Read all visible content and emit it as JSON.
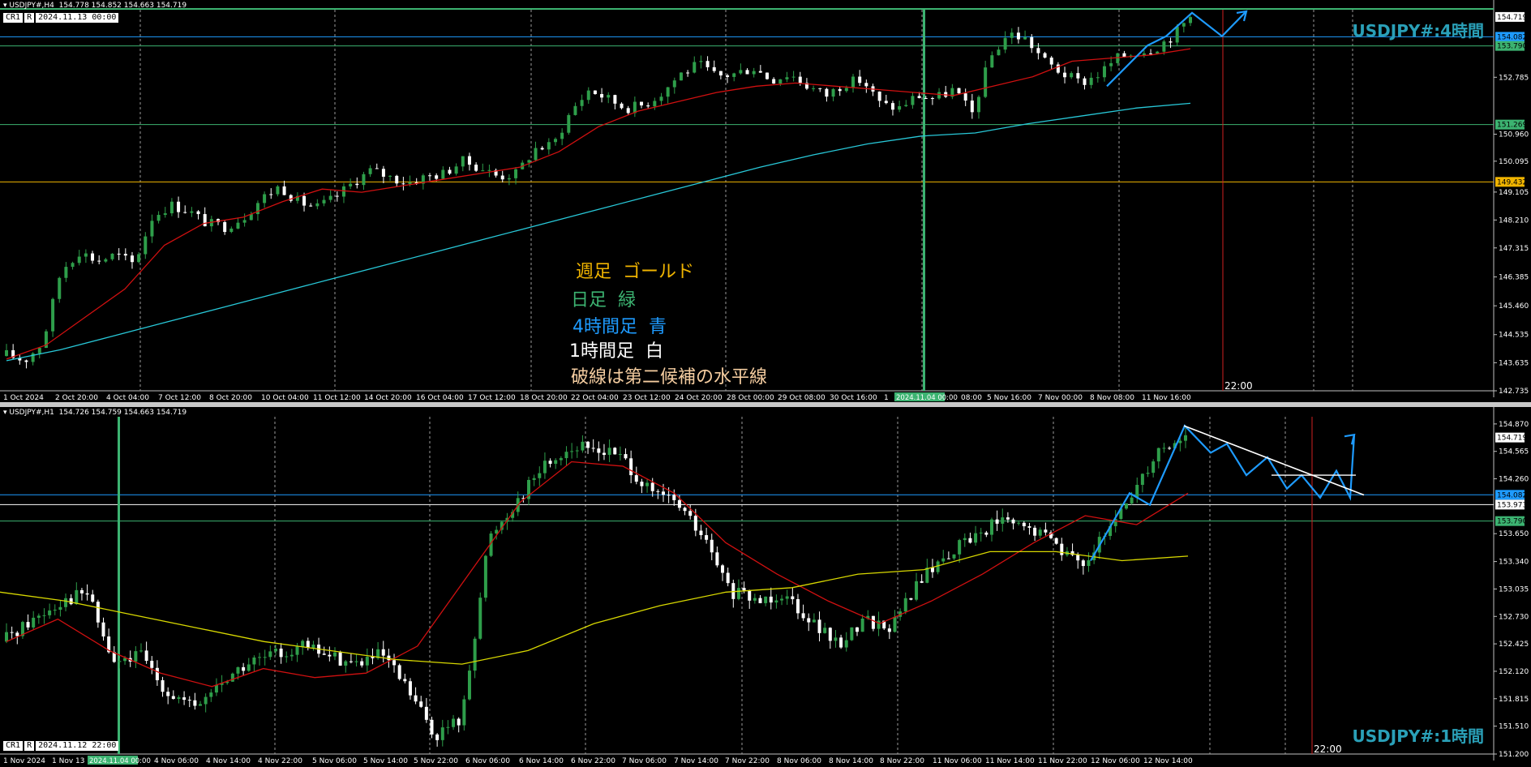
{
  "colors": {
    "weekly_gold": "#f0b400",
    "daily_green": "#3cb371",
    "h4_blue": "#1e9bff",
    "h1_white": "#ffffff",
    "dashed_label": "#f5cda0",
    "ma_red": "#d01010",
    "ma_cyan": "#28c8d8",
    "ma_yellow": "#d8d800",
    "bull": "#2e9e4a",
    "bear": "#ffffff",
    "grid": "#9a9a9a",
    "vline_red": "#d02020",
    "label_teal": "#2aa0b8"
  },
  "h4": {
    "header": "▾ USDJPY#,H4  154.778 154.852 154.663 154.719",
    "cr": "CR1",
    "r": "R",
    "date_box": "2024.11.13 00:00",
    "timeframe_label": "USDJPY#:4時間",
    "vline_label": "22:00",
    "legend": [
      "週足  ゴールド",
      "日足  緑",
      "4時間足  青",
      "1時間足  白",
      "破線は第二候補の水平線"
    ]
  },
  "h1": {
    "header": "▾ USDJPY#,H1  154.726 154.759 154.663 154.719",
    "cr": "CR1",
    "r": "R",
    "date_box": "2024.11.12 22:00",
    "timeframe_label": "USDJPY#:1時間",
    "vline_label": "22:00"
  },
  "chart_data": [
    {
      "type": "candlestick",
      "symbol": "USDJPY#",
      "timeframe": "H4",
      "ylim": [
        142.735,
        154.95
      ],
      "y_ticks": [
        154.719,
        154.082,
        153.79,
        152.785,
        151.269,
        150.96,
        150.095,
        149.432,
        149.105,
        148.21,
        147.315,
        146.385,
        145.46,
        144.535,
        143.635,
        142.735
      ],
      "price_tags": [
        {
          "value": 154.719,
          "style": "white"
        },
        {
          "value": 154.082,
          "style": "blue"
        },
        {
          "value": 153.79,
          "style": "green"
        },
        {
          "value": 151.269,
          "style": "green"
        },
        {
          "value": 149.432,
          "style": "gold"
        }
      ],
      "x_labels": [
        "1 Oct 2024",
        "2 Oct 20:00",
        "4 Oct 04:00",
        "7 Oct 12:00",
        "8 Oct 20:00",
        "10 Oct 04:00",
        "11 Oct 12:00",
        "14 Oct 20:00",
        "16 Oct 04:00",
        "17 Oct 12:00",
        "18 Oct 20:00",
        "22 Oct 04:00",
        "23 Oct 12:00",
        "24 Oct 20:00",
        "28 Oct 00:00",
        "29 Oct 08:00",
        "30 Oct 16:00",
        "1",
        "2024.11.04 00:00",
        "08:00",
        "5 Nov 16:00",
        "7 Nov 00:00",
        "8 Nov 08:00",
        "11 Nov 16:00"
      ],
      "horizontal_lines": [
        {
          "value": 154.082,
          "color": "blue"
        },
        {
          "value": 153.79,
          "color": "green"
        },
        {
          "value": 151.269,
          "color": "green"
        },
        {
          "value": 149.432,
          "color": "gold"
        }
      ],
      "close_path": [
        143.9,
        143.7,
        144.3,
        146.6,
        147.2,
        146.9,
        147.1,
        146.8,
        148.3,
        148.7,
        148.5,
        148.1,
        148.0,
        148.3,
        148.9,
        149.3,
        148.8,
        148.6,
        148.9,
        149.4,
        149.8,
        149.6,
        149.4,
        149.6,
        149.7,
        150.1,
        149.9,
        149.6,
        149.7,
        150.5,
        150.6,
        151.7,
        152.4,
        152.1,
        151.8,
        151.9,
        152.3,
        152.9,
        153.2,
        152.8,
        152.9,
        153.1,
        152.7,
        152.9,
        152.5,
        152.2,
        152.6,
        152.7,
        151.9,
        151.8,
        152.2,
        152.1,
        152.4,
        151.6,
        153.4,
        154.2,
        154.0,
        153.3,
        152.9,
        152.6,
        152.9,
        153.4,
        153.6,
        153.7,
        154.1,
        154.72
      ],
      "ma_red": [
        143.75,
        144.2,
        145.1,
        146.0,
        147.4,
        148.1,
        148.3,
        148.8,
        149.2,
        149.1,
        149.3,
        149.5,
        149.7,
        149.9,
        150.4,
        151.2,
        151.7,
        152.0,
        152.3,
        152.5,
        152.6,
        152.5,
        152.4,
        152.3,
        152.2,
        152.5,
        152.8,
        153.3,
        153.4,
        153.5,
        153.7
      ],
      "ma_cyan": [
        143.7,
        144.05,
        144.5,
        144.95,
        145.4,
        145.85,
        146.3,
        146.75,
        147.2,
        147.65,
        148.1,
        148.55,
        149.0,
        149.45,
        149.9,
        150.3,
        150.65,
        150.9,
        151.0,
        151.3,
        151.55,
        151.8,
        151.95
      ],
      "forecast_path": [
        152.5,
        153.8,
        154.1,
        154.85,
        154.1,
        154.9
      ]
    },
    {
      "type": "candlestick",
      "symbol": "USDJPY#",
      "timeframe": "H1",
      "ylim": [
        151.2,
        154.95
      ],
      "y_ticks": [
        154.87,
        154.719,
        154.565,
        154.26,
        154.082,
        153.973,
        153.79,
        153.65,
        153.34,
        153.035,
        152.73,
        152.425,
        152.12,
        151.815,
        151.51,
        151.2
      ],
      "price_tags": [
        {
          "value": 154.719,
          "style": "white"
        },
        {
          "value": 154.082,
          "style": "blue"
        },
        {
          "value": 153.973,
          "style": "white-box"
        },
        {
          "value": 153.79,
          "style": "green"
        }
      ],
      "x_labels": [
        "1 Nov 2024",
        "1 Nov 13",
        "2024.11.04 00:00",
        "4 Nov 06:00",
        "4 Nov 14:00",
        "4 Nov 22:00",
        "5 Nov 06:00",
        "5 Nov 14:00",
        "5 Nov 22:00",
        "6 Nov 06:00",
        "6 Nov 14:00",
        "6 Nov 22:00",
        "7 Nov 06:00",
        "7 Nov 14:00",
        "7 Nov 22:00",
        "8 Nov 06:00",
        "8 Nov 14:00",
        "8 Nov 22:00",
        "11 Nov 06:00",
        "11 Nov 14:00",
        "11 Nov 22:00",
        "12 Nov 06:00",
        "12 Nov 14:00"
      ],
      "horizontal_lines": [
        {
          "value": 154.082,
          "color": "blue"
        },
        {
          "value": 153.973,
          "color": "white"
        },
        {
          "value": 153.79,
          "color": "green"
        }
      ],
      "close_path": [
        152.5,
        152.7,
        152.9,
        153.0,
        152.2,
        152.3,
        151.9,
        151.7,
        152.0,
        152.2,
        152.3,
        152.4,
        152.3,
        152.2,
        152.3,
        151.9,
        151.4,
        151.6,
        153.6,
        154.0,
        154.4,
        154.6,
        154.6,
        154.5,
        154.1,
        154.0,
        153.6,
        153.0,
        152.9,
        153.0,
        152.7,
        152.4,
        152.7,
        152.6,
        153.1,
        153.4,
        153.6,
        153.8,
        153.7,
        153.6,
        153.3,
        153.6,
        154.1,
        154.6,
        154.72
      ],
      "ma_red": [
        152.45,
        152.7,
        152.35,
        152.1,
        151.95,
        152.15,
        152.05,
        152.1,
        152.4,
        153.2,
        154.0,
        154.45,
        154.4,
        154.1,
        153.55,
        153.2,
        152.9,
        152.65,
        152.9,
        153.2,
        153.55,
        153.85,
        153.75,
        154.1
      ],
      "ma_yellow": [
        153.0,
        152.9,
        152.75,
        152.6,
        152.45,
        152.35,
        152.25,
        152.2,
        152.35,
        152.65,
        152.85,
        153.0,
        153.05,
        153.2,
        153.25,
        153.45,
        153.45,
        153.35,
        153.4
      ],
      "forecast_path": [
        153.35,
        154.1,
        153.97,
        154.85,
        154.55,
        154.65,
        154.3,
        154.5,
        154.15,
        154.3,
        154.05,
        154.35,
        154.05,
        154.75
      ],
      "trendline": [
        154.85,
        154.08
      ],
      "level_line": 154.3
    }
  ]
}
